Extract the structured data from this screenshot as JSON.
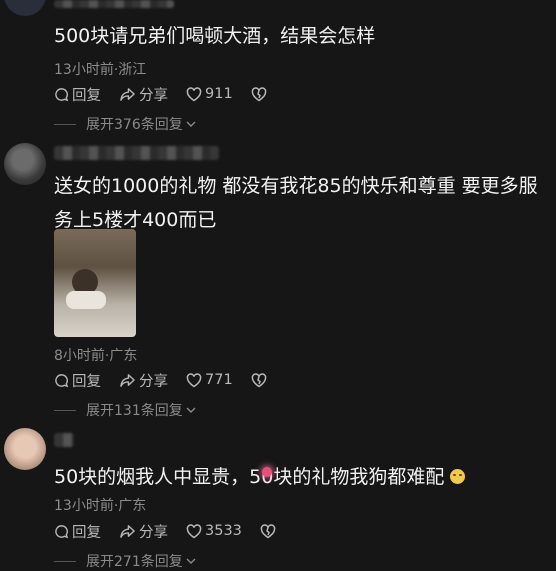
{
  "comments": [
    {
      "text": "500块请兄弟们喝顿大酒，结果会怎样",
      "meta": "13小时前·浙江",
      "reply_label": "回复",
      "share_label": "分享",
      "likes": "911",
      "expand_label": "展开376条回复"
    },
    {
      "text": "送女的1000的礼物 都没有我花85的快乐和尊重 要更多服务上5楼才400而已",
      "meta": "8小时前·广东",
      "reply_label": "回复",
      "share_label": "分享",
      "likes": "771",
      "expand_label": "展开131条回复"
    },
    {
      "text": "50块的烟我人中显贵，50块的礼物我狗都难配",
      "meta": "13小时前·广东",
      "reply_label": "回复",
      "share_label": "分享",
      "likes": "3533",
      "expand_label": "展开271条回复"
    }
  ],
  "icons": {
    "reply": "comment-bubble-icon",
    "share": "share-arrow-icon",
    "like": "heart-icon",
    "dislike": "broken-heart-icon",
    "expand": "chevron-down-icon"
  }
}
